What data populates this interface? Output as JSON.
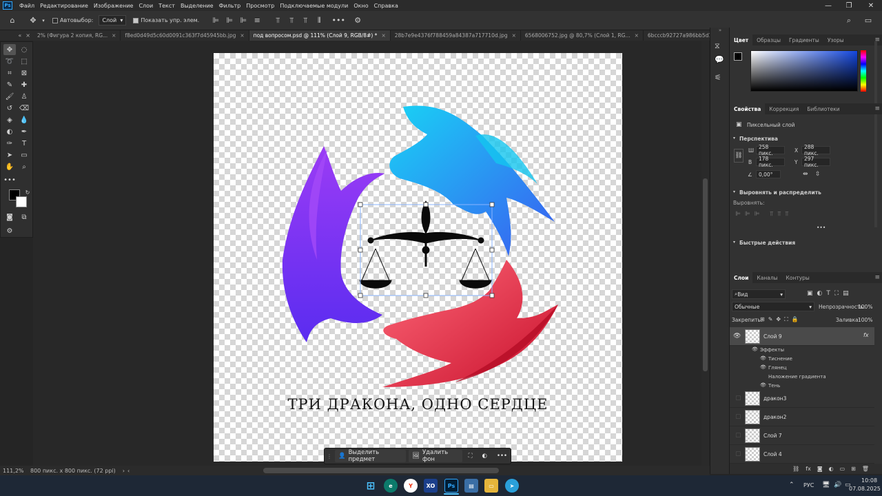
{
  "menu": [
    "Файл",
    "Редактирование",
    "Изображение",
    "Слои",
    "Текст",
    "Выделение",
    "Фильтр",
    "Просмотр",
    "Подключаемые модули",
    "Окно",
    "Справка"
  ],
  "app_logo": "Ps",
  "options": {
    "autoselect_label": "Автовыбор:",
    "autoselect_value": "Слой",
    "show_transform_label": "Показать упр. элем."
  },
  "tabs": [
    {
      "label": "2% (Фигура 2 копия, RG...",
      "active": false
    },
    {
      "label": "f8ed0d49d5c60d0091c363f7d45945bb.jpg",
      "active": false
    },
    {
      "label": "под вопросом.psd @ 111% (Слой 9, RGB/8#) *",
      "active": true
    },
    {
      "label": "28b7e9e4376f788459a84387a717710d.jpg",
      "active": false
    },
    {
      "label": "6568006752.jpg @ 80,7% (Слой 1, RG...",
      "active": false
    },
    {
      "label": "6bcccb92727a986bb5d130428f28f974.jpg",
      "active": false
    }
  ],
  "canvas": {
    "caption": "ТРИ ДРАКОНА, ОДНО СЕРДЦЕ"
  },
  "status": {
    "zoom": "111,2%",
    "doc_info": "800 пикс. x 800 пикс. (72 ppi)"
  },
  "context_bar": {
    "select_subject": "Выделить предмет",
    "remove_bg": "Удалить фон"
  },
  "color_panel": {
    "tabs": [
      "Цвет",
      "Образцы",
      "Градиенты",
      "Узоры"
    ]
  },
  "props_panel": {
    "tabs": [
      "Свойства",
      "Коррекция",
      "Библиотеки"
    ],
    "layer_type": "Пиксельный слой",
    "section_transform": "Перспектива",
    "w_label": "Ш",
    "w_value": "258 пикс.",
    "x_label": "X",
    "x_value": "288 пикс.",
    "h_label": "В",
    "h_value": "178 пикс.",
    "y_label": "Y",
    "y_value": "297 пикс.",
    "angle_value": "0,00°",
    "section_align": "Выровнять и распределить",
    "align_label": "Выровнять:",
    "section_quick": "Быстрые действия"
  },
  "layers_panel": {
    "tabs": [
      "Слои",
      "Каналы",
      "Контуры"
    ],
    "filter": "Вид",
    "blend": "Обычные",
    "opacity_label": "Непрозрачность:",
    "opacity_value": "100%",
    "lock_label": "Закрепить:",
    "fill_label": "Заливка:",
    "fill_value": "100%",
    "layers": [
      {
        "name": "Слой 9",
        "selected": true
      },
      {
        "name": "дракон3",
        "selected": false
      },
      {
        "name": "дракон2",
        "selected": false
      },
      {
        "name": "Слой 7",
        "selected": false
      },
      {
        "name": "Слой 4",
        "selected": false
      }
    ],
    "effects_label": "Эффекты",
    "effects": [
      "Тиснение",
      "Глянец",
      "Наложение градиента",
      "Тень"
    ]
  },
  "taskbar": {
    "lang": "РУС",
    "time": "10:08",
    "date": "07.08.2025"
  },
  "colors": {
    "accent": "#31a8ff",
    "dragon_blue": "#1fb5f0",
    "dragon_purple": "#7a2cf0",
    "dragon_red": "#e3213f"
  }
}
